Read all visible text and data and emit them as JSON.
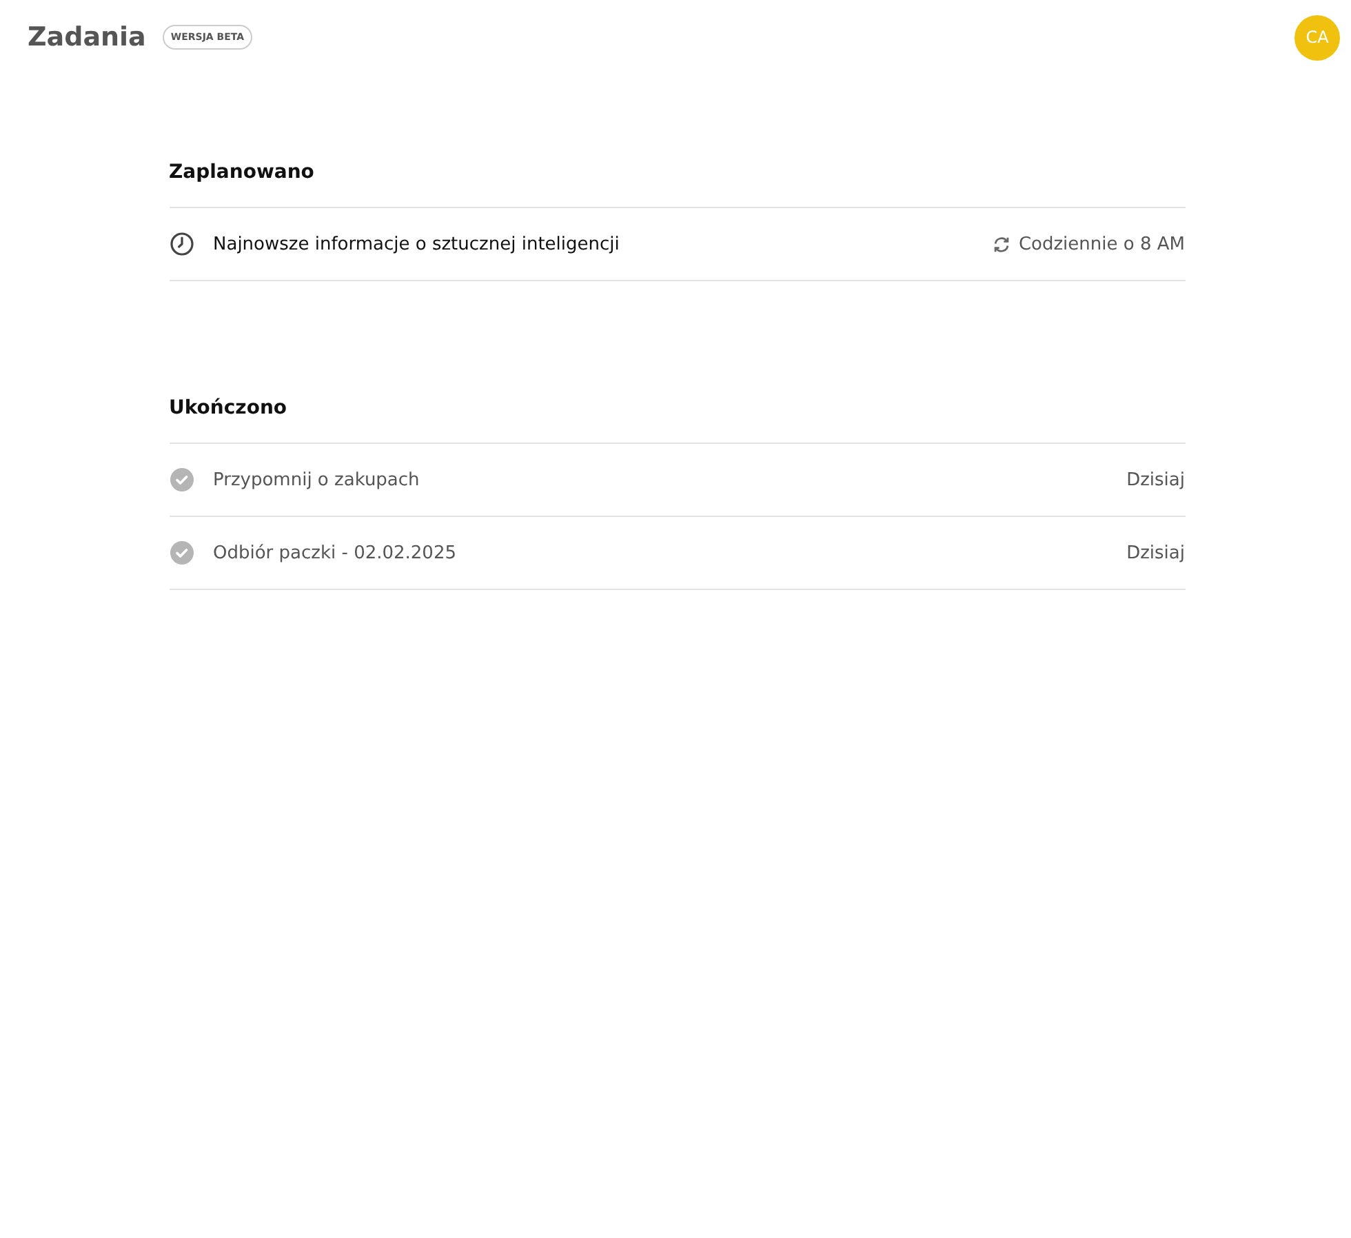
{
  "header": {
    "title": "Zadania",
    "badge": "WERSJA BETA",
    "avatar": "CA"
  },
  "sections": [
    {
      "title": "Zaplanowano",
      "tasks": [
        {
          "kind": "scheduled",
          "title": "Najnowsze informacje o sztucznej inteligencji",
          "when": "Codziennie o 8 AM"
        }
      ]
    },
    {
      "title": "Ukończono",
      "tasks": [
        {
          "kind": "completed",
          "title": "Przypomnij o zakupach",
          "when": "Dzisiaj"
        },
        {
          "kind": "completed",
          "title": "Odbiór paczki - 02.02.2025",
          "when": "Dzisiaj"
        }
      ]
    }
  ]
}
